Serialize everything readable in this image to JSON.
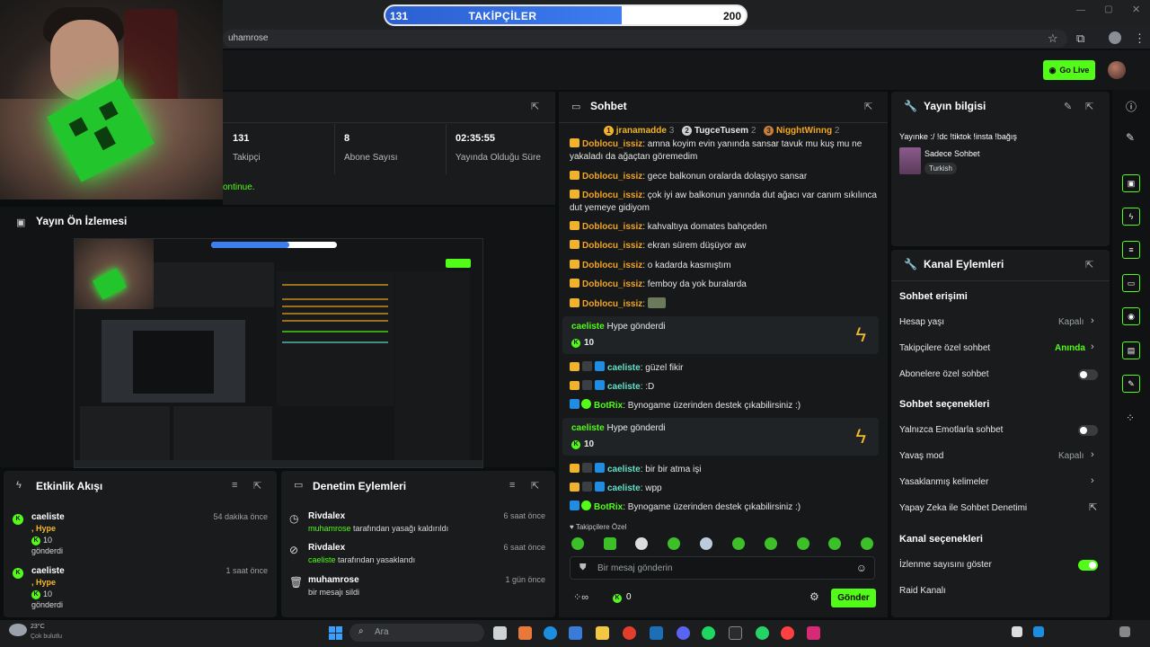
{
  "browser": {
    "url": "uhamrose"
  },
  "header": {
    "go_live_label": "Go Live"
  },
  "followers_goal": {
    "current": "131",
    "target": "200",
    "label": "TAKİPÇİLER",
    "progress": 0.655
  },
  "stats": {
    "followers_value": "131",
    "followers_label": "Takipçi",
    "subs_value": "8",
    "subs_label": "Abone Sayısı",
    "uptime_value": "02:35:55",
    "uptime_label": "Yayında Olduğu Süre",
    "continue_text": "ontinue."
  },
  "preview": {
    "title": "Yayın Ön İzlemesi"
  },
  "activity": {
    "title": "Etkinlik Akışı",
    "items": [
      {
        "name": "caeliste",
        "type": ", Hype",
        "amount": "10",
        "action": "gönderdi",
        "time": "54 dakika önce"
      },
      {
        "name": "caeliste",
        "type": ", Hype",
        "amount": "10",
        "action": "gönderdi",
        "time": "1 saat önce"
      }
    ]
  },
  "moderation": {
    "title": "Denetim Eylemleri",
    "items": [
      {
        "name": "Rivdalex",
        "actor": "muhamrose",
        "text": " tarafından yasağı kaldırıldı",
        "time": "6 saat önce"
      },
      {
        "name": "Rivdalex",
        "actor": "caeliste",
        "text": " tarafından yasaklandı",
        "time": "6 saat önce"
      },
      {
        "name": "muhamrose",
        "actor": "",
        "text": "bir mesajı sildi",
        "time": "1 gün önce"
      }
    ]
  },
  "chat": {
    "title": "Sohbet",
    "top_gifters": [
      {
        "rank": "1",
        "name": "jranamadde",
        "count": "3"
      },
      {
        "rank": "2",
        "name": "TugceTusem",
        "count": "2"
      },
      {
        "rank": "3",
        "name": "NigghtWinng",
        "count": "2"
      }
    ],
    "messages": [
      {
        "user": "Doblocu_issiz",
        "text": ": amna koyim evin yanında sansar tavuk mu kuş mu ne yakaladı da ağaçtan göremedim"
      },
      {
        "user": "Doblocu_issiz",
        "text": ": gece balkonun oralarda dolaşıyo sansar"
      },
      {
        "user": "Doblocu_issiz",
        "text": ": çok iyi aw balkonun yanında dut ağacı var canım sıkılınca dut yemeye gidiyom"
      },
      {
        "user": "Doblocu_issiz",
        "text": ": kahvaltıya domates bahçeden"
      },
      {
        "user": "Doblocu_issiz",
        "text": ": ekran sürem düşüyor aw"
      },
      {
        "user": "Doblocu_issiz",
        "text": ": o kadarda kasmıştım"
      },
      {
        "user": "Doblocu_issiz",
        "text": ": femboy da yok buralarda"
      },
      {
        "user": "Doblocu_issiz",
        "text": ":"
      }
    ],
    "hype1": {
      "user": "caeliste",
      "text": " Hype gönderdi",
      "amount": "10"
    },
    "messages2": [
      {
        "user": "caeliste",
        "text": ": güzel fikir"
      },
      {
        "user": "caeliste",
        "text": ": :D"
      },
      {
        "user": "BotRix",
        "text": ": Bynogame üzerinden destek çıkabilirsiniz :)"
      }
    ],
    "hype2": {
      "user": "caeliste",
      "text": " Hype gönderdi",
      "amount": "10"
    },
    "messages3": [
      {
        "user": "caeliste",
        "text": ": bir bir atma işi"
      },
      {
        "user": "caeliste",
        "text": ": wpp"
      },
      {
        "user": "BotRix",
        "text": ": Bynogame üzerinden destek çıkabilirsiniz :)"
      }
    ],
    "follower_only": "Takipçilere Özel",
    "input_placeholder": "Bir mesaj gönderin",
    "points": "0",
    "send_label": "Gönder"
  },
  "stream_info": {
    "title": "Yayın bilgisi",
    "stream_title": "Yayınke :/ !dc !tiktok !insta !bağış",
    "category": "Sadece Sohbet",
    "language": "Turkish"
  },
  "channel_actions": {
    "title": "Kanal Eylemleri",
    "section1": "Sohbet erişimi",
    "account_age": {
      "label": "Hesap yaşı",
      "value": "Kapalı"
    },
    "followers_only": {
      "label": "Takipçilere özel sohbet",
      "value": "Anında"
    },
    "subs_only": {
      "label": "Abonelere özel sohbet",
      "on": false
    },
    "section2": "Sohbet seçenekleri",
    "emote_only": {
      "label": "Yalnızca Emotlarla sohbet",
      "on": false
    },
    "slow_mode": {
      "label": "Yavaş mod",
      "value": "Kapalı"
    },
    "banned_words": {
      "label": "Yasaklanmış kelimeler"
    },
    "ai_mod": {
      "label": "Yapay Zeka ile Sohbet Denetimi"
    },
    "section3": "Kanal seçenekleri",
    "show_viewers": {
      "label": "İzlenme sayısını göster",
      "on": true
    },
    "raid": {
      "label": "Raid Kanalı"
    }
  },
  "taskbar": {
    "search_placeholder": "Ara",
    "weather": "23°C",
    "weather_desc": "Çok bulutlu"
  },
  "colors": {
    "accent": "#53fc18",
    "panel": "#191b1c",
    "goal_bar": "#2a5fd1",
    "gold_user": "#f5a623"
  }
}
